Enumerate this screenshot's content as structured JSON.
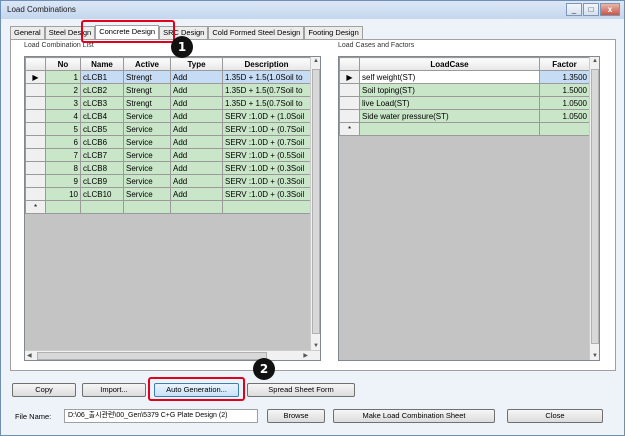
{
  "window": {
    "title": "Load Combinations",
    "controls": [
      "_",
      "□",
      "x"
    ]
  },
  "tabs": [
    "General",
    "Steel Design",
    "Concrete Design",
    "SRC Design",
    "Cold Formed Steel Design",
    "Footing Design"
  ],
  "combo_group": {
    "label": "Load Combination List",
    "headers": [
      "No",
      "Name",
      "Active",
      "Type",
      "Description"
    ],
    "rows": [
      {
        "no": "1",
        "name": "cLCB1",
        "active": "Strengt",
        "type": "Add",
        "desc": "1.35D + 1.5(1.0Soil to"
      },
      {
        "no": "2",
        "name": "cLCB2",
        "active": "Strengt",
        "type": "Add",
        "desc": "1.35D + 1.5(0.7Soil to"
      },
      {
        "no": "3",
        "name": "cLCB3",
        "active": "Strengt",
        "type": "Add",
        "desc": "1.35D + 1.5(0.7Soil to"
      },
      {
        "no": "4",
        "name": "cLCB4",
        "active": "Service",
        "type": "Add",
        "desc": "SERV :1.0D + (1.0Soil"
      },
      {
        "no": "5",
        "name": "cLCB5",
        "active": "Service",
        "type": "Add",
        "desc": "SERV :1.0D + (0.7Soil"
      },
      {
        "no": "6",
        "name": "cLCB6",
        "active": "Service",
        "type": "Add",
        "desc": "SERV :1.0D + (0.7Soil"
      },
      {
        "no": "7",
        "name": "cLCB7",
        "active": "Service",
        "type": "Add",
        "desc": "SERV :1.0D + (0.5Soil"
      },
      {
        "no": "8",
        "name": "cLCB8",
        "active": "Service",
        "type": "Add",
        "desc": "SERV :1.0D + (0.3Soil"
      },
      {
        "no": "9",
        "name": "cLCB9",
        "active": "Service",
        "type": "Add",
        "desc": "SERV :1.0D + (0.3Soil"
      },
      {
        "no": "10",
        "name": "cLCB10",
        "active": "Service",
        "type": "Add",
        "desc": "SERV :1.0D + (0.3Soil"
      }
    ],
    "new_row_marker": "*",
    "current_row_marker": "▶"
  },
  "cases_group": {
    "label": "Load Cases and Factors",
    "headers": [
      "LoadCase",
      "Factor"
    ],
    "rows": [
      {
        "case": "self weight(ST)",
        "factor": "1.3500"
      },
      {
        "case": "Soil toping(ST)",
        "factor": "1.5000"
      },
      {
        "case": "live Load(ST)",
        "factor": "1.0500"
      },
      {
        "case": "Side water pressure(ST)",
        "factor": "1.0500"
      }
    ]
  },
  "buttons": {
    "copy": "Copy",
    "import": "Import...",
    "auto_generation": "Auto Generation...",
    "spreadsheet": "Spread Sheet Form",
    "browse": "Browse",
    "make_sheet": "Make Load Combination Sheet",
    "close": "Close"
  },
  "file": {
    "label": "File Name:",
    "value": "D:\\06_출시관련\\00_Gen\\5379 C+G Plate Design (2)"
  },
  "callouts": [
    "1",
    "2"
  ],
  "colors": {
    "highlight": "#e0001b",
    "row_green": "#c9e6c9",
    "row_selected": "#c6dcf5"
  }
}
